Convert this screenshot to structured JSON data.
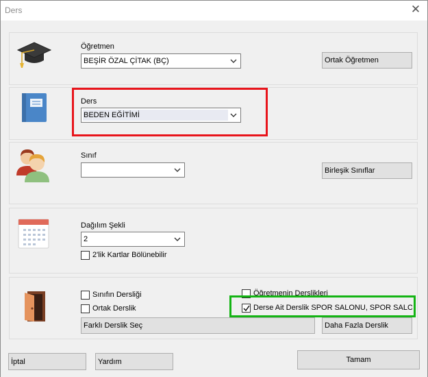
{
  "window": {
    "title": "Ders"
  },
  "teacher": {
    "label": "Öğretmen",
    "value": "BEŞİR ÖZAL ÇİTAK (BÇ)",
    "joint_button": "Ortak Öğretmen"
  },
  "lesson": {
    "label": "Ders",
    "value": "BEDEN EĞİTİMİ"
  },
  "class": {
    "label": "Sınıf",
    "value": "",
    "merged_button": "Birleşik Sınıflar"
  },
  "distribution": {
    "label": "Dağılım Şekli",
    "value": "2",
    "divisible_label": "2'lik Kartlar Bölünebilir",
    "divisible_checked": false
  },
  "classroom": {
    "class_room_label": "Sınıfın Dersliği",
    "class_room_checked": false,
    "shared_room_label": "Ortak Derslik",
    "shared_room_checked": false,
    "teacher_rooms_label": "Öğretmenin Derslikleri",
    "teacher_rooms_checked": false,
    "lesson_rooms_label": "Derse Ait Derslik SPOR SALONU, SPOR SALON",
    "lesson_rooms_checked": true,
    "other_room_button": "Farklı Derslik Seç",
    "more_rooms_button": "Daha Fazla Derslik"
  },
  "footer": {
    "cancel": "İptal",
    "help": "Yardım",
    "ok": "Tamam"
  },
  "highlights": {
    "red": "#e8141b",
    "green": "#14b414"
  },
  "icons": [
    "close-icon",
    "graduation-cap-icon",
    "book-icon",
    "users-icon",
    "calendar-icon",
    "door-icon",
    "chevron-down-icon",
    "checkmark-icon"
  ]
}
